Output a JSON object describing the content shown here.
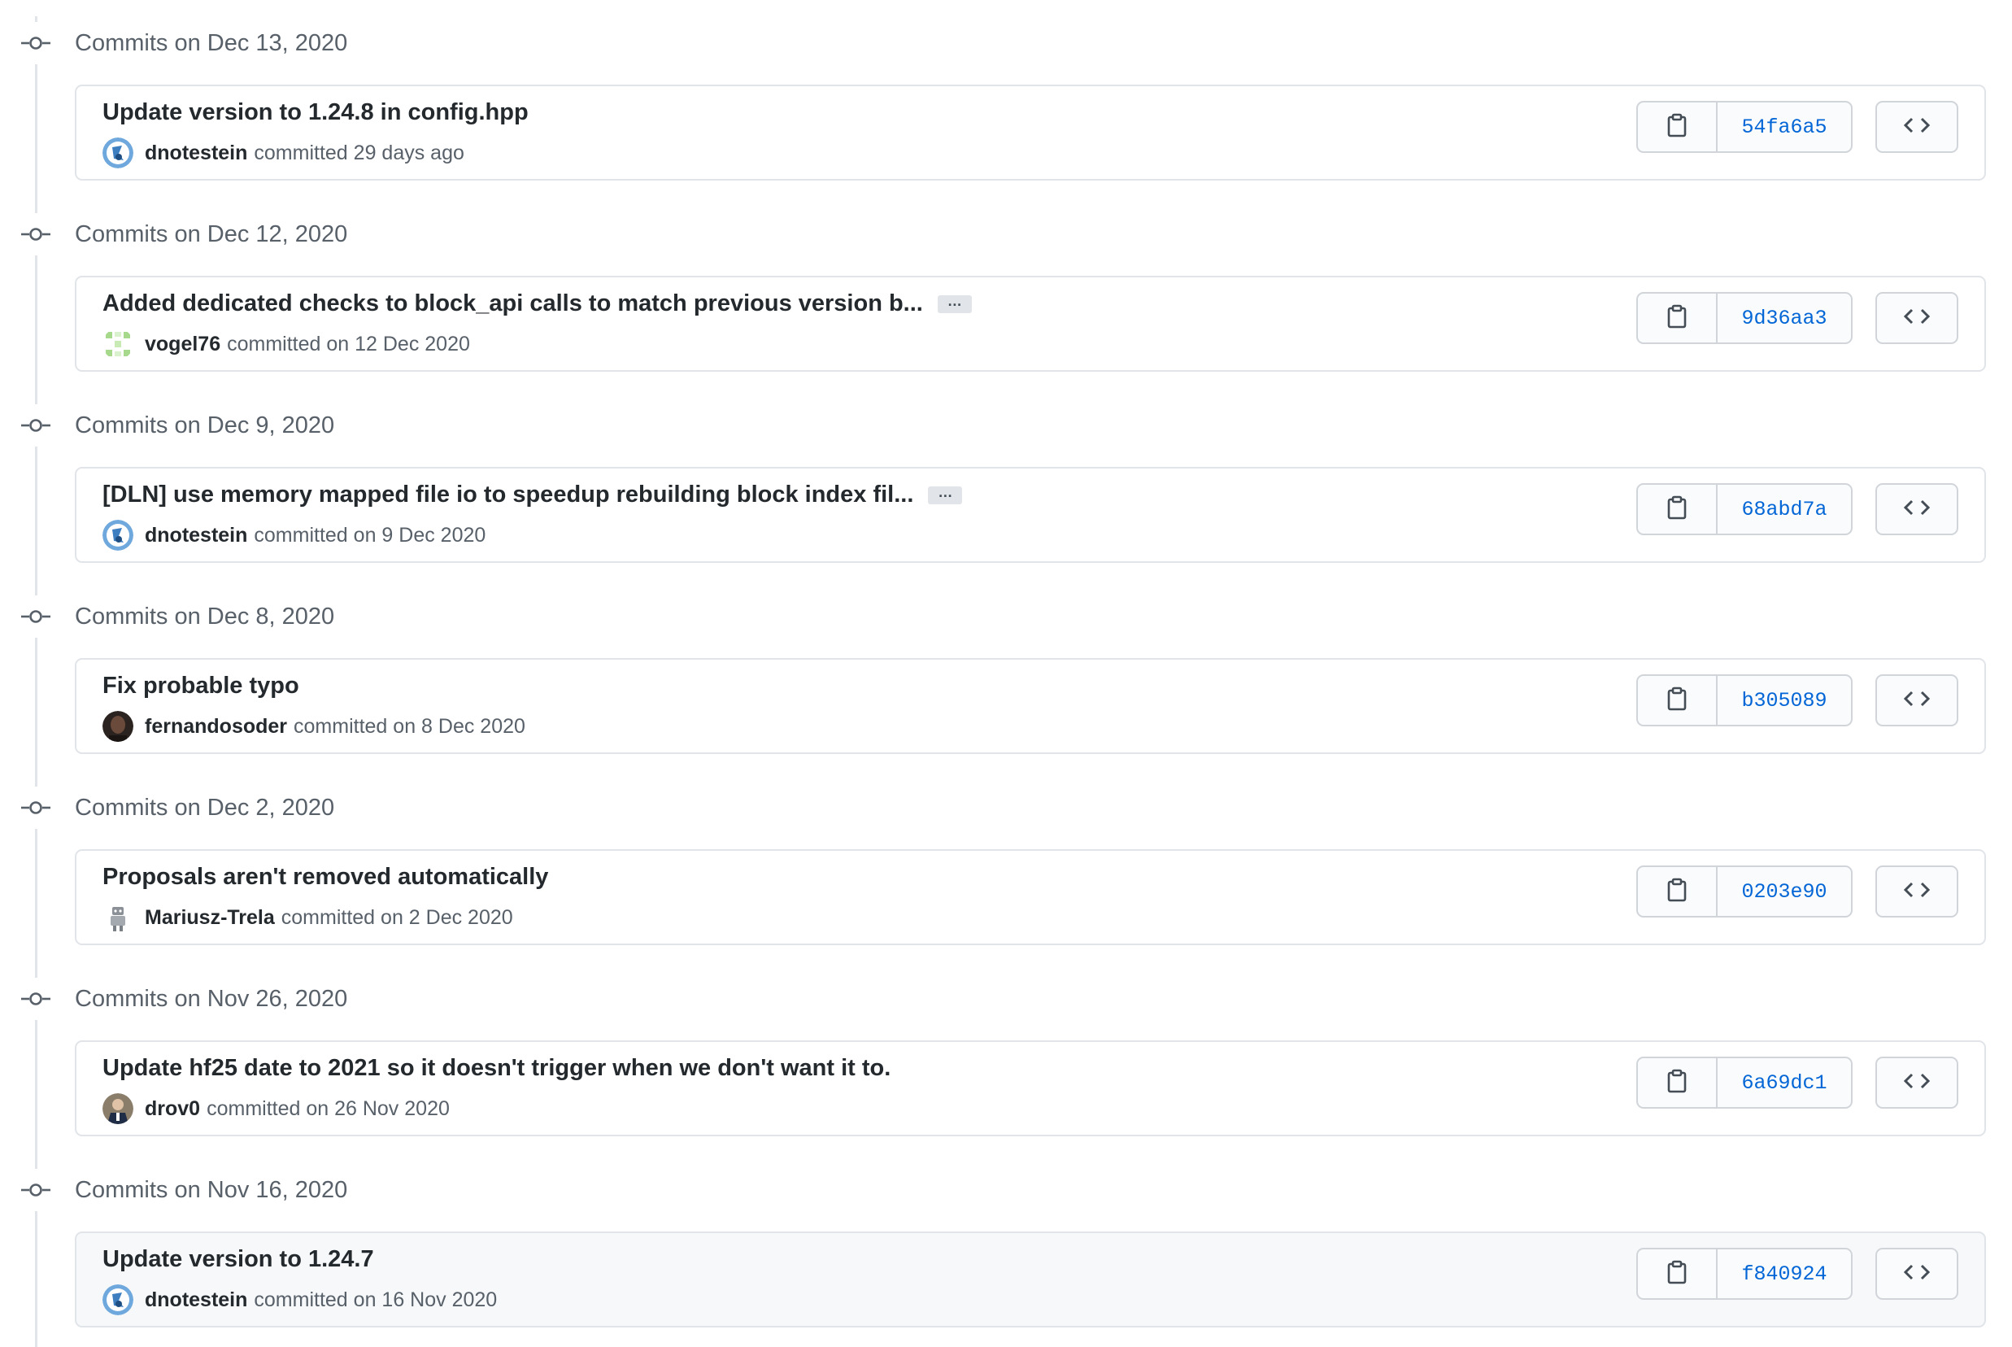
{
  "groups": [
    {
      "date_header": "Commits on Dec 13, 2020",
      "commit": {
        "title": "Update version to 1.24.8 in config.hpp",
        "truncated": false,
        "author": "dnotestein",
        "meta": "committed 29 days ago",
        "sha": "54fa6a5",
        "avatar": "avatar-dnotestein"
      }
    },
    {
      "date_header": "Commits on Dec 12, 2020",
      "commit": {
        "title": "Added dedicated checks to block_api calls to match previous version b...",
        "truncated": true,
        "ellipsis": "…",
        "author": "vogel76",
        "meta": "committed on 12 Dec 2020",
        "sha": "9d36aa3",
        "avatar": "avatar-vogel76"
      }
    },
    {
      "date_header": "Commits on Dec 9, 2020",
      "commit": {
        "title": "[DLN] use memory mapped file io to speedup rebuilding block index fil...",
        "truncated": true,
        "ellipsis": "…",
        "author": "dnotestein",
        "meta": "committed on 9 Dec 2020",
        "sha": "68abd7a",
        "avatar": "avatar-dnotestein"
      }
    },
    {
      "date_header": "Commits on Dec 8, 2020",
      "commit": {
        "title": "Fix probable typo",
        "truncated": false,
        "author": "fernandosoder",
        "meta": "committed on 8 Dec 2020",
        "sha": "b305089",
        "avatar": "avatar-fernandosoder"
      }
    },
    {
      "date_header": "Commits on Dec 2, 2020",
      "commit": {
        "title": "Proposals aren't removed automatically",
        "truncated": false,
        "author": "Mariusz-Trela",
        "meta": "committed on 2 Dec 2020",
        "sha": "0203e90",
        "avatar": "avatar-mariusz-trela"
      }
    },
    {
      "date_header": "Commits on Nov 26, 2020",
      "commit": {
        "title": "Update hf25 date to 2021 so it doesn't trigger when we don't want it to.",
        "truncated": false,
        "author": "drov0",
        "meta": "committed on 26 Nov 2020",
        "sha": "6a69dc1",
        "avatar": "avatar-drov0"
      }
    },
    {
      "date_header": "Commits on Nov 16, 2020",
      "commit": {
        "title": "Update version to 1.24.7",
        "truncated": false,
        "author": "dnotestein",
        "meta": "committed on 16 Nov 2020",
        "sha": "f840924",
        "avatar": "avatar-dnotestein",
        "hovered": true
      }
    }
  ],
  "icons": {
    "timeline_node": "git-commit-icon",
    "copy": "clipboard-icon",
    "browse": "code-icon"
  },
  "colors": {
    "link": "#0366d6",
    "border": "#e1e4e8",
    "muted_text": "#586069",
    "hover_background": "#f6f8fa"
  }
}
